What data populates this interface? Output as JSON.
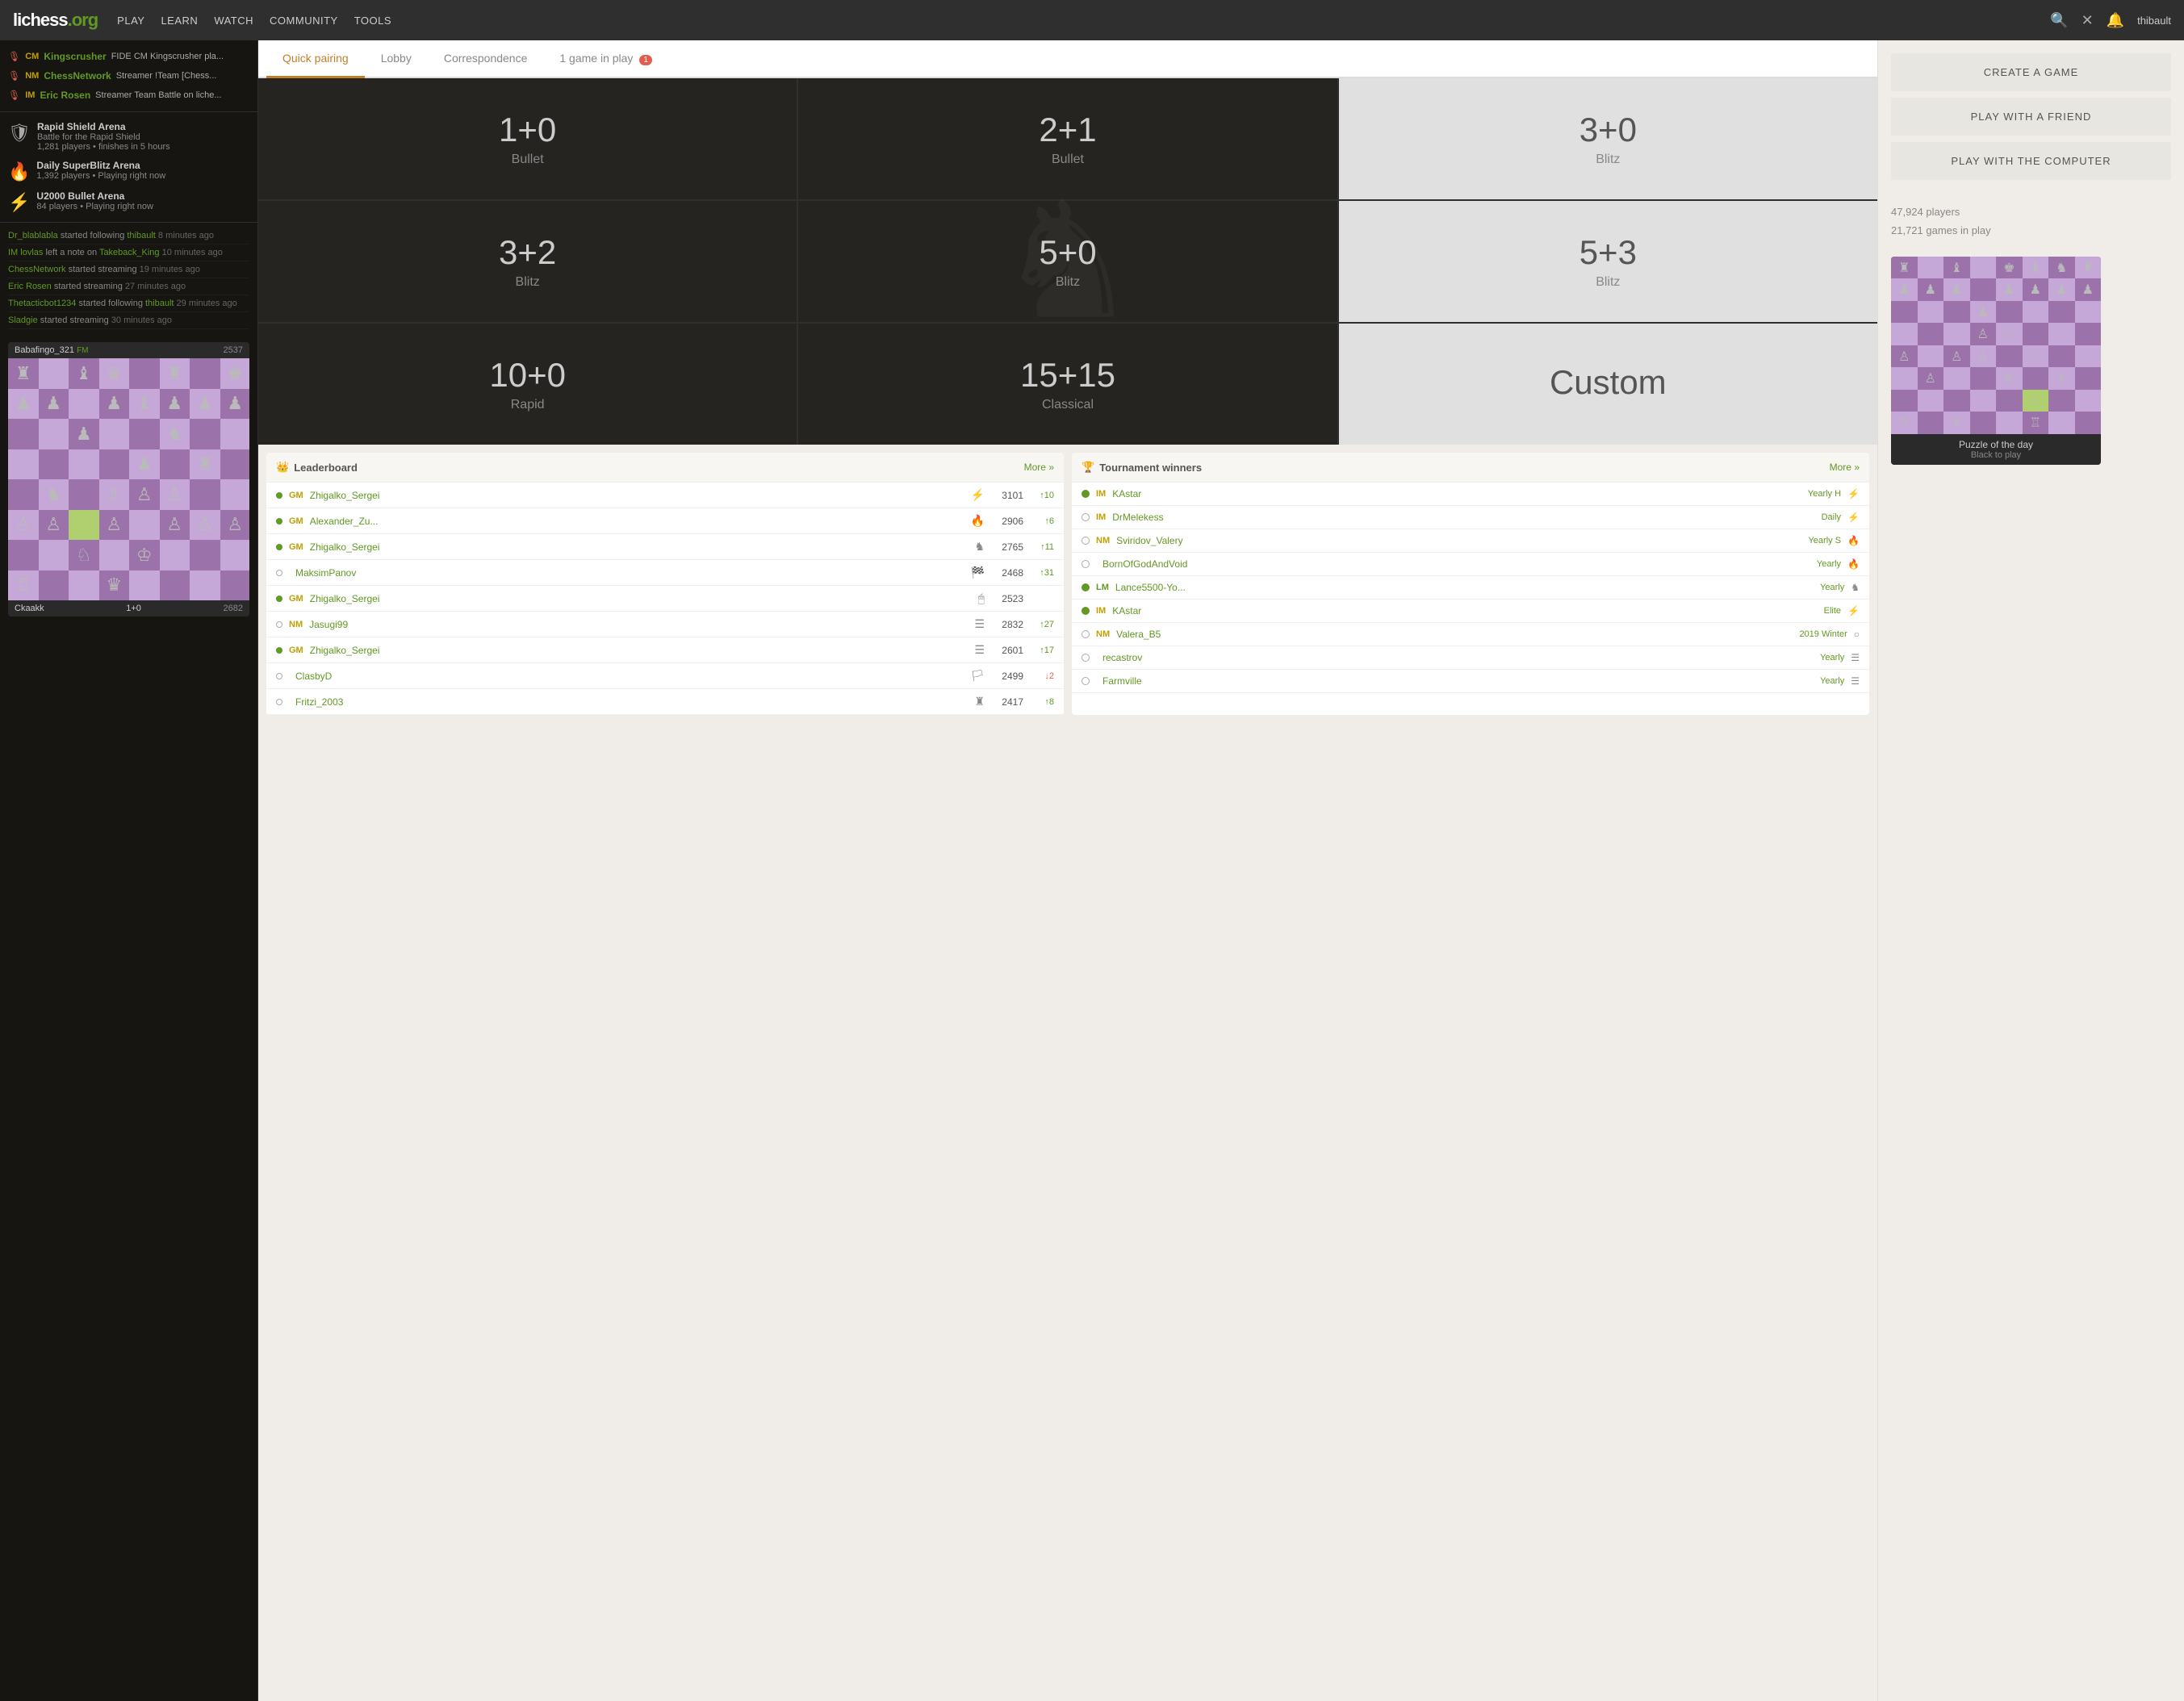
{
  "nav": {
    "logo": "lichess",
    "logo_suffix": ".org",
    "links": [
      "PLAY",
      "LEARN",
      "WATCH",
      "COMMUNITY",
      "TOOLS"
    ],
    "user": "thibault",
    "games_badge": "1"
  },
  "sidebar": {
    "streamers": [
      {
        "rank": "CM",
        "name": "Kingscrusher",
        "desc": "FIDE CM Kingscrusher pla..."
      },
      {
        "rank": "NM",
        "name": "ChessNetwork",
        "desc": "Streamer !Team [Chess..."
      },
      {
        "rank": "IM",
        "name": "Eric Rosen",
        "desc": "Streamer Team Battle on liche..."
      }
    ],
    "events": [
      {
        "icon": "🛡",
        "name": "Rapid Shield Arena",
        "sub1": "Battle for the Rapid Shield",
        "sub2": "1,281 players • finishes in 5 hours"
      },
      {
        "icon": "🔥",
        "name": "Daily SuperBlitz Arena",
        "sub1": "1,392 players • Playing right now",
        "sub2": ""
      },
      {
        "icon": "⚡",
        "name": "U2000 Bullet Arena",
        "sub1": "84 players • Playing right now",
        "sub2": ""
      }
    ],
    "activity": [
      {
        "text": "Dr_blablabla started following thibault",
        "time": "8 minutes ago"
      },
      {
        "text": "IM lovlas left a note on Takeback_King",
        "time": "10 minutes ago"
      },
      {
        "text": "ChessNetwork started streaming",
        "time": "19 minutes ago"
      },
      {
        "text": "Eric Rosen started streaming",
        "time": "27 minutes ago"
      },
      {
        "text": "Thetacticbot1234 started following thibault",
        "time": "29 minutes ago"
      },
      {
        "text": "Sladgie started streaming",
        "time": "30 minutes ago"
      }
    ],
    "mini_board": {
      "white_player": "Ckaakk",
      "white_rating": "2682",
      "black_player": "Babafingo_321",
      "black_rating": "2537",
      "black_title": "FM",
      "control": "1+0"
    }
  },
  "tabs": [
    {
      "label": "Quick pairing",
      "active": true
    },
    {
      "label": "Lobby",
      "active": false
    },
    {
      "label": "Correspondence",
      "active": false
    },
    {
      "label": "1 game in play",
      "active": false,
      "badge": "1"
    }
  ],
  "pairing": [
    {
      "time": "1+0",
      "type": "Bullet",
      "dark": true
    },
    {
      "time": "2+1",
      "type": "Bullet",
      "dark": true
    },
    {
      "time": "3+0",
      "type": "Blitz",
      "dark": false
    },
    {
      "time": "3+2",
      "type": "Blitz",
      "dark": true
    },
    {
      "time": "5+0",
      "type": "Blitz",
      "dark": true
    },
    {
      "time": "5+3",
      "type": "Blitz",
      "dark": false
    },
    {
      "time": "10+0",
      "type": "Rapid",
      "dark": true
    },
    {
      "time": "15+15",
      "type": "Classical",
      "dark": true
    },
    {
      "time": "Custom",
      "type": "",
      "dark": false
    }
  ],
  "right_panel": {
    "create_label": "CREATE A GAME",
    "friend_label": "PLAY WITH A FRIEND",
    "computer_label": "PLAY WITH THE COMPUTER",
    "players_count": "47,924 players",
    "games_count": "21,721 games in play"
  },
  "leaderboard": {
    "title": "Leaderboard",
    "more": "More »",
    "rows": [
      {
        "online": true,
        "title": "GM",
        "name": "Zhigalko_Sergei",
        "icon": "⚡",
        "rating": "3101",
        "trend": "↑10",
        "trend_dir": "up"
      },
      {
        "online": true,
        "title": "GM",
        "name": "Alexander_Zu...",
        "icon": "🔥",
        "rating": "2906",
        "trend": "↑6",
        "trend_dir": "up"
      },
      {
        "online": true,
        "title": "GM",
        "name": "Zhigalko_Sergei",
        "icon": "♞",
        "rating": "2765",
        "trend": "↑11",
        "trend_dir": "up"
      },
      {
        "online": false,
        "title": "",
        "name": "MaksimPanov",
        "icon": "🏁",
        "rating": "2468",
        "trend": "↑31",
        "trend_dir": "up"
      },
      {
        "online": true,
        "title": "GM",
        "name": "Zhigalko_Sergei",
        "icon": "🖱",
        "rating": "2523",
        "trend": "",
        "trend_dir": ""
      },
      {
        "online": false,
        "title": "NM",
        "name": "Jasugi99",
        "icon": "☰",
        "rating": "2832",
        "trend": "↑27",
        "trend_dir": "up"
      },
      {
        "online": true,
        "title": "GM",
        "name": "Zhigalko_Sergei",
        "icon": "☰",
        "rating": "2601",
        "trend": "↑17",
        "trend_dir": "up"
      },
      {
        "online": false,
        "title": "",
        "name": "ClasbyD",
        "icon": "🏳",
        "rating": "2499",
        "trend": "↓2",
        "trend_dir": "down"
      },
      {
        "online": false,
        "title": "",
        "name": "Fritzi_2003",
        "icon": "♜",
        "rating": "2417",
        "trend": "↑8",
        "trend_dir": "up"
      }
    ]
  },
  "tournament_winners": {
    "title": "Tournament winners",
    "more": "More »",
    "rows": [
      {
        "online": true,
        "title": "IM",
        "name": "KAstar",
        "tourney": "Yearly H",
        "icon": "⚡"
      },
      {
        "online": false,
        "title": "IM",
        "name": "DrMelekess",
        "tourney": "Daily",
        "icon": "⚡"
      },
      {
        "online": false,
        "title": "NM",
        "name": "Sviridov_Valery",
        "tourney": "Yearly S",
        "icon": "🔥"
      },
      {
        "online": false,
        "title": "",
        "name": "BornOfGodAndVoid",
        "tourney": "Yearly",
        "icon": "🔥"
      },
      {
        "online": true,
        "title": "LM",
        "name": "Lance5500-Yo...",
        "tourney": "Yearly",
        "icon": "♞"
      },
      {
        "online": true,
        "title": "IM",
        "name": "KAstar",
        "tourney": "Elite",
        "icon": "⚡"
      },
      {
        "online": false,
        "title": "NM",
        "name": "Valera_B5",
        "tourney": "2019 Winter",
        "icon": "○"
      },
      {
        "online": false,
        "title": "",
        "name": "recastrov",
        "tourney": "Yearly",
        "icon": "☰"
      },
      {
        "online": false,
        "title": "",
        "name": "Farmville",
        "tourney": "Yearly",
        "icon": "☰"
      }
    ]
  },
  "puzzle": {
    "title": "Puzzle of the day",
    "sub": "Black to play"
  }
}
